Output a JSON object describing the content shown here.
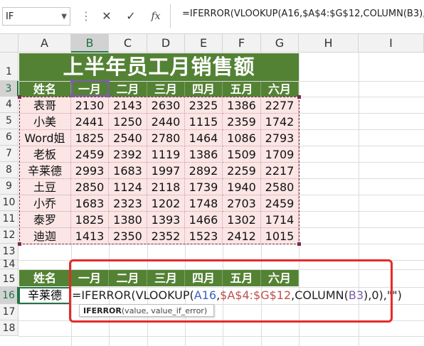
{
  "formula_bar": {
    "name_box": "IF",
    "formula": "=IFERROR(VLOOKUP(A16,$A$4:$G$12,COLUMN(B3),"
  },
  "columns": [
    "A",
    "B",
    "C",
    "D",
    "E",
    "F",
    "G",
    "H",
    "I"
  ],
  "rows": [
    "1",
    "3",
    "4",
    "5",
    "6",
    "7",
    "8",
    "9",
    "10",
    "11",
    "12",
    "13",
    "14",
    "15",
    "16",
    "17",
    "18"
  ],
  "table": {
    "title": "上半年员工月销售额",
    "header": [
      "姓名",
      "一月",
      "二月",
      "三月",
      "四月",
      "五月",
      "六月"
    ],
    "data": [
      [
        "表哥",
        "2130",
        "2143",
        "2630",
        "2325",
        "1386",
        "2277"
      ],
      [
        "小美",
        "2441",
        "1250",
        "2440",
        "1115",
        "2359",
        "1742"
      ],
      [
        "Word姐",
        "1825",
        "2540",
        "2780",
        "1464",
        "1086",
        "2793"
      ],
      [
        "老板",
        "2459",
        "2392",
        "1119",
        "1386",
        "1509",
        "1709"
      ],
      [
        "辛莱德",
        "2993",
        "1683",
        "1997",
        "2892",
        "2259",
        "2217"
      ],
      [
        "土豆",
        "2850",
        "1124",
        "2118",
        "1739",
        "1940",
        "2580"
      ],
      [
        "小乔",
        "1683",
        "2323",
        "1202",
        "1748",
        "2703",
        "2459"
      ],
      [
        "泰罗",
        "1825",
        "1380",
        "1393",
        "1466",
        "1302",
        "1714"
      ],
      [
        "迪迦",
        "1413",
        "2350",
        "2352",
        "1523",
        "2412",
        "1015"
      ]
    ]
  },
  "lookup": {
    "header": [
      "姓名",
      "一月",
      "二月",
      "三月",
      "四月",
      "五月",
      "六月"
    ],
    "name_value": "辛莱德",
    "editing": {
      "p1": "=IFERROR(VLOOKUP(",
      "ref1": "A16",
      "c1": ",",
      "ref2": "$A$4:$G$12",
      "c2": ",COLUMN(",
      "ref3": "B3",
      "tail": "),0),\"\")"
    },
    "tooltip": {
      "func": "IFERROR",
      "args": "(value, value_if_error)"
    }
  },
  "colors": {
    "header_green": "#548235",
    "data_pink": "#fbe5e5",
    "highlight_red": "#e52a2a",
    "selection_green": "#217346"
  },
  "icons": [
    "dropdown-icon",
    "cancel-icon",
    "enter-icon",
    "insert-function-icon"
  ]
}
